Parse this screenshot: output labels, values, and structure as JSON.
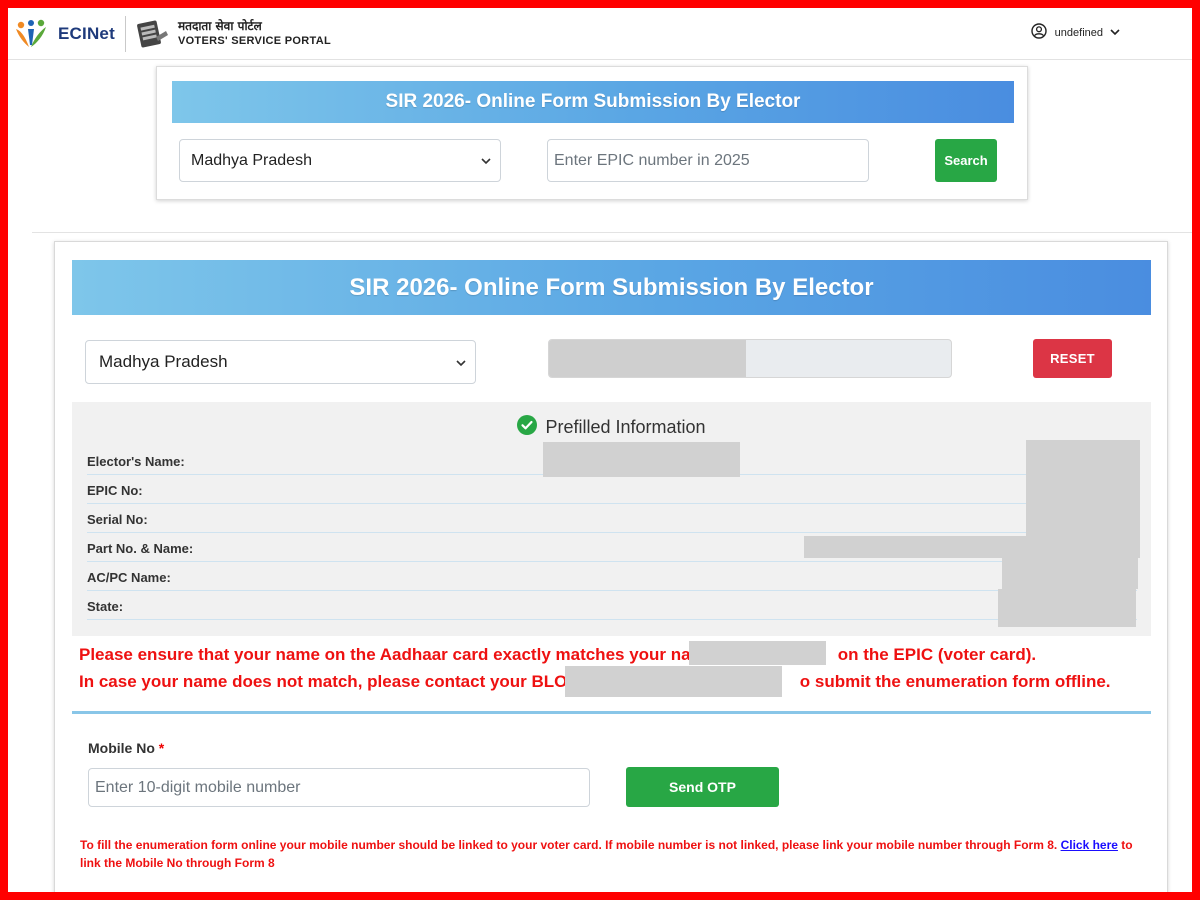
{
  "header": {
    "brand_name": "ECINet",
    "portal_hindi": "मतदाता सेवा पोर्टल",
    "portal_english": "VOTERS' SERVICE PORTAL",
    "user_label": "undefined"
  },
  "top_form": {
    "title": "SIR 2026- Online Form Submission By Elector",
    "state_selected": "Madhya Pradesh",
    "epic_placeholder": "Enter EPIC number in 2025",
    "search_label": "Search"
  },
  "main_form": {
    "title": "SIR 2026- Online Form Submission By Elector",
    "state_selected": "Madhya Pradesh",
    "progress_fraction": 0.49,
    "reset_label": "RESET",
    "prefill": {
      "heading": "Prefilled Information",
      "fields": [
        {
          "label": "Elector's Name:"
        },
        {
          "label": "EPIC No:"
        },
        {
          "label": "Serial No:"
        },
        {
          "label": "Part No. & Name:"
        },
        {
          "label": "AC/PC Name:"
        },
        {
          "label": "State:"
        }
      ]
    },
    "warning_line1_a": "Please ensure that your name on the Aadhaar card exactly matches your nam",
    "warning_line1_b": "on the EPIC (voter card).",
    "warning_line2_a": "In case your name does not match, please contact your BLO -",
    "warning_line2_b": "o submit the enumeration form offline.",
    "mobile_label": "Mobile No",
    "mobile_required_mark": "*",
    "mobile_placeholder": "Enter 10-digit mobile number",
    "send_otp_label": "Send OTP",
    "note_text": "To fill the enumeration form online your mobile number should be linked to your voter card. If mobile number is not linked, please link your mobile number through Form 8.",
    "note_link": "Click here",
    "note_tail": "to link the Mobile No through Form 8"
  },
  "colors": {
    "frame": "#ff0000",
    "banner_start": "#7ec6ea",
    "banner_end": "#4a8de0",
    "green_button": "#28a745",
    "red_button": "#dc3545",
    "warning_text": "#ee1111",
    "check": "#28a745"
  },
  "icons": {
    "brand": "eci-logo-icon",
    "portal": "evm-icon",
    "user": "user-circle-icon",
    "dropdown": "chevron-down-icon",
    "prefill": "check-circle-icon"
  }
}
